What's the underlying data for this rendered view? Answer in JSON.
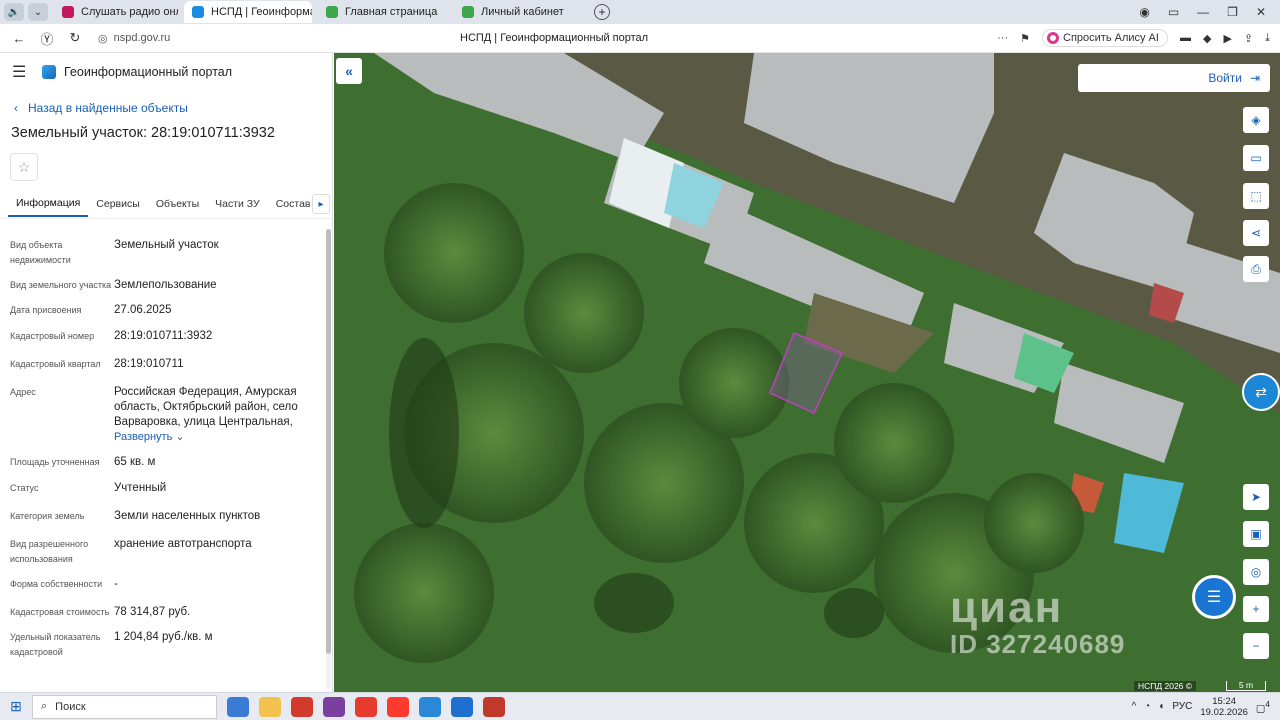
{
  "browser": {
    "tabs": [
      {
        "label": "Слушать радио онл",
        "active": false,
        "color": "#c2185b"
      },
      {
        "label": "НСПД | Геоинформац",
        "active": true,
        "color": "#1a8de0"
      },
      {
        "label": "Главная страница",
        "active": false,
        "color": "#3ea64b"
      },
      {
        "label": "Личный кабинет",
        "active": false,
        "color": "#3ea64b"
      }
    ],
    "url": "nspd.gov.ru",
    "page_title": "НСПД | Геоинформационный портал",
    "alice_label": "Спросить Алису AI"
  },
  "panel": {
    "portal_title": "Геоинформационный портал",
    "back_label": "Назад в найденные объекты",
    "parcel_title": "Земельный участок: 28:19:010711:3932",
    "tabs": [
      "Информация",
      "Сервисы",
      "Объекты",
      "Части ЗУ",
      "Состав"
    ],
    "props": [
      {
        "label": "Вид объекта недвижимости",
        "value": "Земельный участок"
      },
      {
        "label": "Вид земельного участка",
        "value": "Землепользование"
      },
      {
        "label": "Дата присвоения",
        "value": "27.06.2025"
      },
      {
        "label": "Кадастровый номер",
        "value": "28:19:010711:3932"
      },
      {
        "label": "Кадастровый квартал",
        "value": "28:19:010711"
      },
      {
        "label": "Адрес",
        "value": "Российская Федерация, Амурская область, Октябрьский район, село Варваровка, улица Центральная,"
      },
      {
        "label": "Площадь уточненная",
        "value": "65 кв. м"
      },
      {
        "label": "Статус",
        "value": "Учтенный"
      },
      {
        "label": "Категория земель",
        "value": "Земли населенных пунктов"
      },
      {
        "label": "Вид разрешенного использования",
        "value": "хранение автотранспорта"
      },
      {
        "label": "Форма собственности",
        "value": "-"
      },
      {
        "label": "Кадастровая стоимость",
        "value": "78 314,87 руб."
      },
      {
        "label": "Удельный показатель кадастровой",
        "value": "1 204,84 руб./кв. м"
      }
    ],
    "expand_label": "Развернуть"
  },
  "map": {
    "login_label": "Войти",
    "watermark_brand": "циан",
    "watermark_id": "ID 327240689",
    "attribution": "НСПД 2026 ©",
    "scale_label": "5 m"
  },
  "taskbar": {
    "search_label": "Поиск",
    "lang": "РУС",
    "time": "15:24",
    "date": "19.02.2026",
    "notifications": "4"
  },
  "colors": {
    "accent": "#1a5fb4",
    "parcel_outline": "#c13ec2"
  }
}
